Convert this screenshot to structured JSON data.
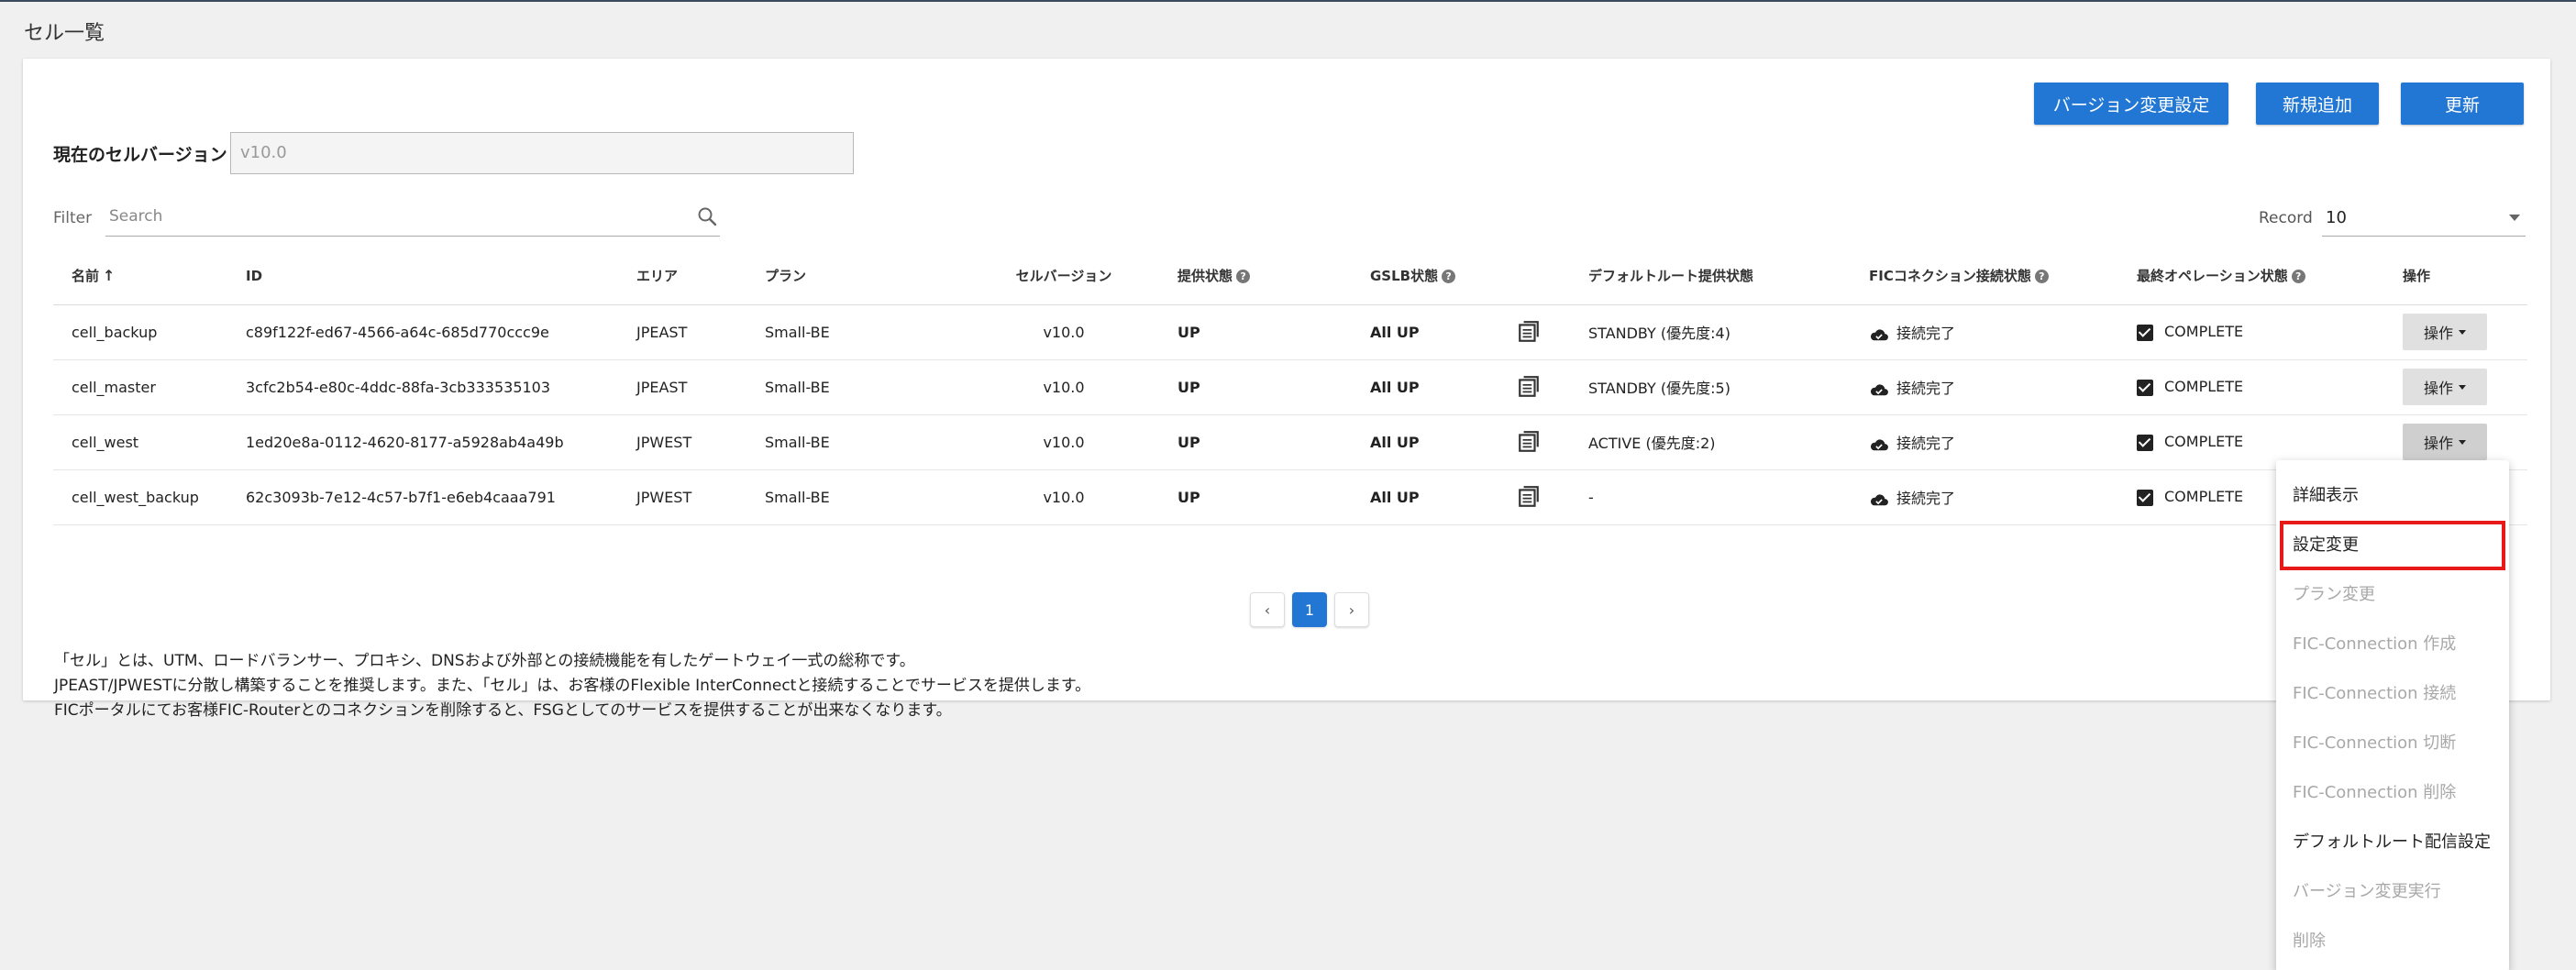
{
  "page_title": "セル一覧",
  "toolbar": {
    "version_change_settings": "バージョン変更設定",
    "add_new": "新規追加",
    "refresh": "更新"
  },
  "current_version": {
    "label": "現在のセルバージョン",
    "value": "v10.0"
  },
  "filter": {
    "label": "Filter",
    "placeholder": "Search",
    "icon": "search-icon"
  },
  "record": {
    "label": "Record",
    "value": "10"
  },
  "table": {
    "headers": {
      "name": "名前",
      "id": "ID",
      "area": "エリア",
      "plan": "プラン",
      "cell_version": "セルバージョン",
      "provision_status": "提供状態",
      "gslb_status": "GSLB状態",
      "default_route": "デフォルトルート提供状態",
      "fic_connection": "FICコネクション接続状態",
      "last_operation": "最終オペレーション状態",
      "operation": "操作"
    },
    "rows": [
      {
        "name": "cell_backup",
        "id": "c89f122f-ed67-4566-a64c-685d770ccc9e",
        "area": "JPEAST",
        "plan": "Small-BE",
        "version": "v10.0",
        "provision": "UP",
        "gslb": "All UP",
        "default_route": "STANDBY (優先度:4)",
        "fic": "接続完了",
        "last_op": "COMPLETE",
        "op_label": "操作"
      },
      {
        "name": "cell_master",
        "id": "3cfc2b54-e80c-4ddc-88fa-3cb333535103",
        "area": "JPEAST",
        "plan": "Small-BE",
        "version": "v10.0",
        "provision": "UP",
        "gslb": "All UP",
        "default_route": "STANDBY (優先度:5)",
        "fic": "接続完了",
        "last_op": "COMPLETE",
        "op_label": "操作"
      },
      {
        "name": "cell_west",
        "id": "1ed20e8a-0112-4620-8177-a5928ab4a49b",
        "area": "JPWEST",
        "plan": "Small-BE",
        "version": "v10.0",
        "provision": "UP",
        "gslb": "All UP",
        "default_route": "ACTIVE (優先度:2)",
        "fic": "接続完了",
        "last_op": "COMPLETE",
        "op_label": "操作"
      },
      {
        "name": "cell_west_backup",
        "id": "62c3093b-7e12-4c57-b7f1-e6eb4caaa791",
        "area": "JPWEST",
        "plan": "Small-BE",
        "version": "v10.0",
        "provision": "UP",
        "gslb": "All UP",
        "default_route": "-",
        "fic": "接続完了",
        "last_op": "COMPLETE",
        "op_label": "操作"
      }
    ]
  },
  "pagination": {
    "prev": "‹",
    "current": "1",
    "next": "›"
  },
  "notes": [
    "「セル」とは、UTM、ロードバランサー、プロキシ、DNSおよび外部との接続機能を有したゲートウェイ一式の総称です。",
    "JPEAST/JPWESTに分散し構築することを推奨します。また、「セル」は、お客様のFlexible InterConnectと接続することでサービスを提供します。",
    "FICポータルにてお客様FIC-Routerとのコネクションを削除すると、FSGとしてのサービスを提供することが出来なくなります。"
  ],
  "dropdown_menu": {
    "items": [
      {
        "label": "詳細表示",
        "enabled": true
      },
      {
        "label": "設定変更",
        "enabled": true,
        "highlighted": true
      },
      {
        "label": "プラン変更",
        "enabled": false
      },
      {
        "label": "FIC-Connection 作成",
        "enabled": false
      },
      {
        "label": "FIC-Connection 接続",
        "enabled": false
      },
      {
        "label": "FIC-Connection 切断",
        "enabled": false
      },
      {
        "label": "FIC-Connection 削除",
        "enabled": false
      },
      {
        "label": "デフォルトルート配信設定",
        "enabled": true
      },
      {
        "label": "バージョン変更実行",
        "enabled": false
      },
      {
        "label": "削除",
        "enabled": false
      }
    ]
  },
  "colors": {
    "primary": "#2277d4",
    "status_green": "#1b8a2a",
    "highlight_red": "#e81919"
  }
}
